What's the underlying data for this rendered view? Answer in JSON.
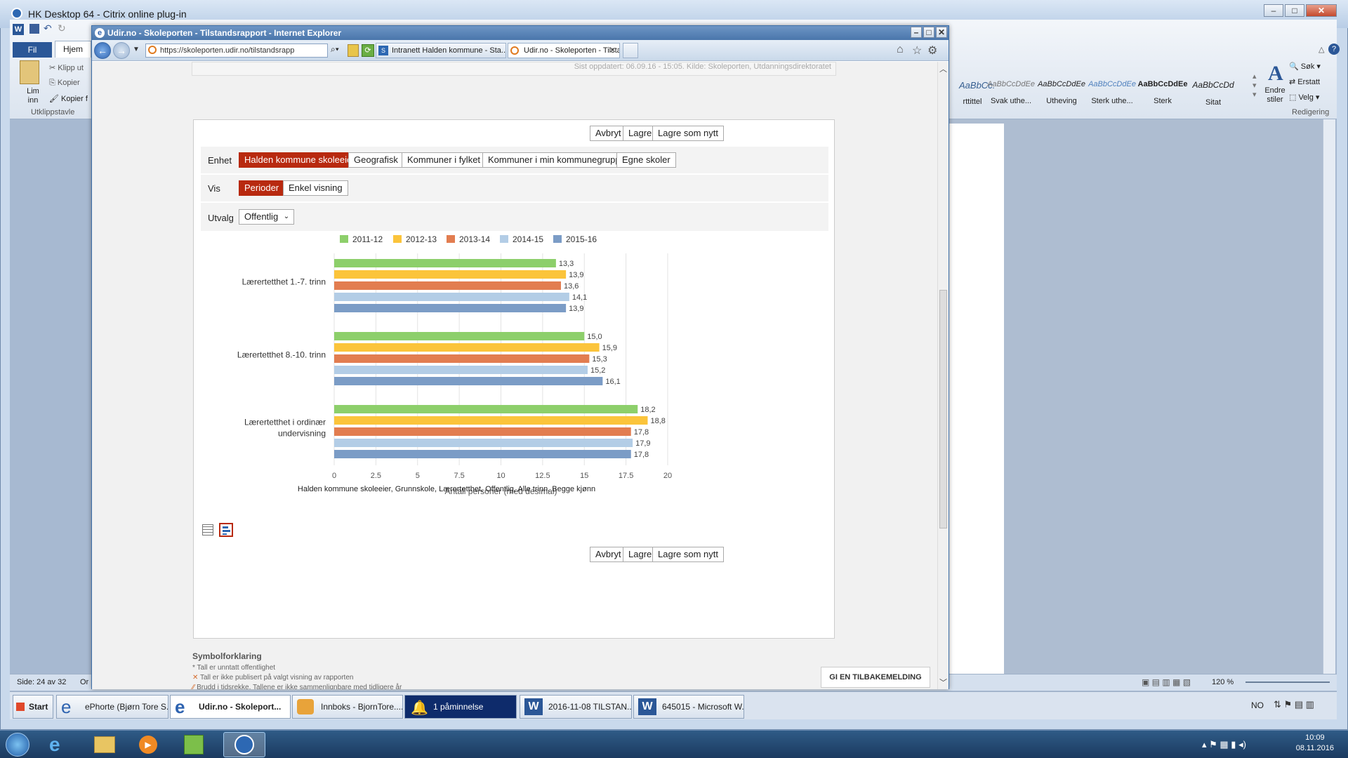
{
  "citrix": {
    "title": "HK Desktop 64 - Citrix online plug-in"
  },
  "word": {
    "file_tab": "Fil",
    "home_tab": "Hjem",
    "paste": "Lim inn",
    "cut": "Klipp ut",
    "copy": "Kopier",
    "format_painter": "Kopier f",
    "clipboard_group": "Utklippstavle",
    "styles": [
      {
        "preview": "AaBbCc.",
        "name": "rttittel"
      },
      {
        "preview": "AaBbCcDdEe",
        "name": "Svak uthe..."
      },
      {
        "preview": "AaBbCcDdEe",
        "name": "Utheving"
      },
      {
        "preview": "AaBbCcDdEe",
        "name": "Sterk uthe..."
      },
      {
        "preview": "AaBbCcDdEe",
        "name": "Sterk"
      },
      {
        "preview": "AaBbCcDd",
        "name": "Sitat"
      }
    ],
    "change_styles": "Endre stiler",
    "search": "Søk",
    "replace": "Erstatt",
    "select": "Velg",
    "editing_group": "Redigering",
    "status_page": "Side: 24 av 32",
    "status_more": "Or",
    "zoom": "120 %"
  },
  "ie": {
    "title": "Udir.no - Skoleporten - Tilstandsrapport - Internet Explorer",
    "address": "https://skoleporten.udir.no/tilstandsrapp",
    "tabs": [
      "Intranett Halden kommune - Sta...",
      "Udir.no - Skoleporten - Tilsta..."
    ]
  },
  "page": {
    "updated": "Sist oppdatert: 06.09.16 - 15:05. Kilde: Skoleporten, Utdanningsdirektoratet",
    "buttons": {
      "cancel": "Avbryt",
      "save": "Lagre",
      "save_new": "Lagre som nytt"
    },
    "enhet_label": "Enhet",
    "enhet_options": [
      "Halden kommune skoleeier",
      "Geografisk",
      "Kommuner i fylket",
      "Kommuner i min kommunegruppe",
      "Egne skoler"
    ],
    "vis_label": "Vis",
    "vis_options": [
      "Perioder",
      "Enkel visning"
    ],
    "utvalg_label": "Utvalg",
    "utvalg_value": "Offentlig",
    "footnote": "Halden kommune skoleeier, Grunnskole, Lærertetthet, Offentlig, Alle trinn, Begge kjønn",
    "symbols_title": "Symbolforklaring",
    "symbols": [
      "Tall er unntatt offentlighet",
      "Tall er ikke publisert på valgt visning av rapporten",
      "Brudd i tidsrekke. Tallene er ikke sammenlignbare med tidligere år"
    ],
    "feedback": "GI EN TILBAKEMELDING"
  },
  "chart_data": {
    "type": "bar",
    "orientation": "horizontal",
    "categories": [
      "Lærertetthet 1.-7. trinn",
      "Lærertetthet 8.-10. trinn",
      "Lærertetthet i ordinær undervisning"
    ],
    "series": [
      {
        "name": "2011-12",
        "color": "#8dcf6b",
        "values": [
          13.3,
          15.0,
          18.2
        ],
        "labels": [
          "13,3",
          "15,0",
          "18,2"
        ]
      },
      {
        "name": "2012-13",
        "color": "#fbc43b",
        "values": [
          13.9,
          15.9,
          18.8
        ],
        "labels": [
          "13,9",
          "15,9",
          "18,8"
        ]
      },
      {
        "name": "2013-14",
        "color": "#e27d50",
        "values": [
          13.6,
          15.3,
          17.8
        ],
        "labels": [
          "13,6",
          "15,3",
          "17,8"
        ]
      },
      {
        "name": "2014-15",
        "color": "#b3cde6",
        "values": [
          14.1,
          15.2,
          17.9
        ],
        "labels": [
          "14,1",
          "15,2",
          "17,9"
        ]
      },
      {
        "name": "2015-16",
        "color": "#7b9cc6",
        "values": [
          13.9,
          16.1,
          17.8
        ],
        "labels": [
          "13,9",
          "16,1",
          "17,8"
        ]
      }
    ],
    "xlim": [
      0,
      20
    ],
    "xticks": [
      "0",
      "2.5",
      "5",
      "7.5",
      "10",
      "12.5",
      "15",
      "17.5",
      "20"
    ],
    "xlabel": "Antall personer (med desimal)",
    "grid": true,
    "legend": "top"
  },
  "taskbar": {
    "start": "Start",
    "items": [
      "ePhorte (Bjørn Tore S...",
      "Udir.no - Skoleport...",
      "Innboks - BjornTore....",
      "1 påminnelse",
      "2016-11-08  TILSTAN...",
      "645015 - Microsoft W..."
    ],
    "lang": "NO",
    "time": "10:09",
    "date": "08.11.2016"
  }
}
